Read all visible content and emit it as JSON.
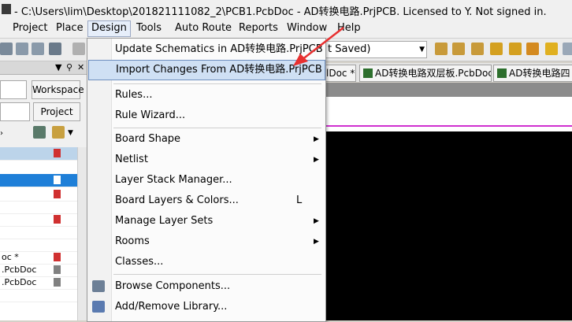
{
  "window": {
    "title": "- C:\\Users\\lim\\Desktop\\201821111082_2\\PCB1.PcbDoc - AD转换电路.PrjPCB. Licensed to Y. Not signed in."
  },
  "menubar": {
    "items": [
      "Project",
      "Place",
      "Design",
      "Tools",
      "Auto Route",
      "Reports",
      "Window",
      "Help"
    ],
    "open_item": "Design"
  },
  "toolbar": {
    "combo_value": "t Saved)"
  },
  "left_panel": {
    "workspace_button": "Workspace",
    "project_button": "Project",
    "tree_rows": [
      {
        "label": "",
        "icon_color": "#d03030"
      },
      {
        "label": "",
        "icon_color": "#ffffff"
      },
      {
        "label": "",
        "icon_color": "#d03030"
      },
      {
        "label": "",
        "icon_color": "#d03030"
      },
      {
        "label": "",
        "icon_color": "#d03030"
      },
      {
        "label": "",
        "icon_color": "#d03030"
      },
      {
        "label": "oc *",
        "icon_color": "#d03030"
      },
      {
        "label": ".PcbDoc",
        "icon_color": "#707070"
      },
      {
        "label": ".PcbDoc",
        "icon_color": "#707070"
      }
    ]
  },
  "document_tabs": [
    {
      "label": "lDoc *"
    },
    {
      "label": "AD转换电路双层板.PcbDoc"
    },
    {
      "label": "AD转换电路四"
    }
  ],
  "design_menu": {
    "items": [
      {
        "label": "Update Schematics in AD转换电路.PrjPCB",
        "shortcut": "",
        "submenu": false
      },
      {
        "label": "Import Changes From AD转换电路.PrjPCB",
        "shortcut": "",
        "submenu": false,
        "highlighted": true
      },
      {
        "label": "Rules...",
        "shortcut": "",
        "submenu": false
      },
      {
        "label": "Rule Wizard...",
        "shortcut": "",
        "submenu": false
      },
      {
        "label": "Board Shape",
        "shortcut": "",
        "submenu": true
      },
      {
        "label": "Netlist",
        "shortcut": "",
        "submenu": true
      },
      {
        "label": "Layer Stack Manager...",
        "shortcut": "",
        "submenu": false
      },
      {
        "label": "Board Layers & Colors...",
        "shortcut": "L",
        "submenu": false
      },
      {
        "label": "Manage Layer Sets",
        "shortcut": "",
        "submenu": true
      },
      {
        "label": "Rooms",
        "shortcut": "",
        "submenu": true
      },
      {
        "label": "Classes...",
        "shortcut": "",
        "submenu": false
      },
      {
        "label": "Browse Components...",
        "shortcut": "",
        "submenu": false
      },
      {
        "label": "Add/Remove Library...",
        "shortcut": "",
        "submenu": false
      }
    ]
  },
  "colors": {
    "highlight": "#cfe0f4",
    "arrow": "#e83030",
    "canvas": "#000000",
    "selection": "#1e7fd8"
  }
}
